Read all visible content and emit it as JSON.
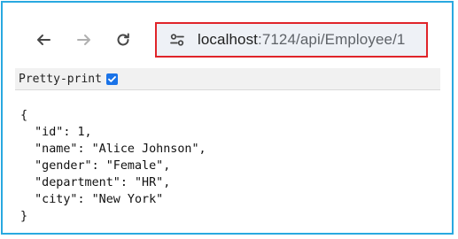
{
  "browser": {
    "url_domain": "localhost",
    "url_path": ":7124/api/Employee/1",
    "highlight_color": "#e0242a",
    "frame_color": "#29a9e0",
    "icons": [
      "back-arrow-icon",
      "forward-arrow-icon",
      "reload-icon",
      "site-info-icon"
    ]
  },
  "viewer": {
    "pretty_print_label": "Pretty-print",
    "pretty_print_checked": true
  },
  "json_lines": [
    "{",
    "  \"id\": 1,",
    "  \"name\": \"Alice Johnson\",",
    "  \"gender\": \"Female\",",
    "  \"department\": \"HR\",",
    "  \"city\": \"New York\"",
    "}"
  ]
}
